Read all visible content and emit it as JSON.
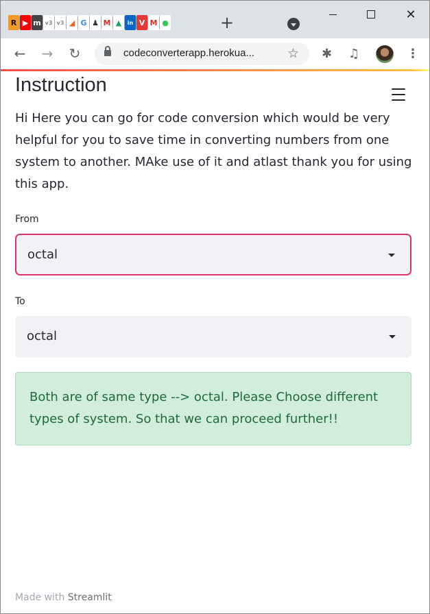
{
  "browser": {
    "tab_favicons": [
      {
        "name": "r-icon",
        "glyph": "R",
        "bg": "#f59a23",
        "fg": "#111111"
      },
      {
        "name": "youtube-icon",
        "glyph": "▶",
        "bg": "#ff0000",
        "fg": "#ffffff"
      },
      {
        "name": "app-icon",
        "glyph": "m",
        "bg": "#444444",
        "fg": "#ffffff"
      },
      {
        "name": "v3-icon",
        "glyph": "v3",
        "bg": "#ffffff",
        "fg": "#888888"
      },
      {
        "name": "v3-icon",
        "glyph": "v3",
        "bg": "#ffffff",
        "fg": "#888888"
      },
      {
        "name": "pdf-icon",
        "glyph": "◢",
        "bg": "#ffffff",
        "fg": "#e0662c"
      },
      {
        "name": "google-icon",
        "glyph": "G",
        "bg": "#ffffff",
        "fg": "#4285f4"
      },
      {
        "name": "person-icon",
        "glyph": "♟",
        "bg": "#ffffff",
        "fg": "#333333"
      },
      {
        "name": "gmail-icon",
        "glyph": "M",
        "bg": "#ffffff",
        "fg": "#d93025"
      },
      {
        "name": "drive-icon",
        "glyph": "▲",
        "bg": "#ffffff",
        "fg": "#1fa463"
      },
      {
        "name": "linkedin-icon",
        "glyph": "in",
        "bg": "#0a66c2",
        "fg": "#ffffff"
      },
      {
        "name": "v-red-icon",
        "glyph": "V",
        "bg": "#e53935",
        "fg": "#ffffff"
      },
      {
        "name": "gmail-icon",
        "glyph": "M",
        "bg": "#ffffff",
        "fg": "#d93025"
      },
      {
        "name": "green-dot-icon",
        "glyph": "●",
        "bg": "#ffffff",
        "fg": "#34c759"
      }
    ],
    "new_tab": "+",
    "url": "codeconverterapp.herokua...",
    "close_glyph": "✕"
  },
  "app": {
    "title": "Instruction",
    "instruction": "Hi Here you can go for code conversion which would be very helpful for you to save time in converting numbers from one system to another. MAke use of it and atlast thank you for using this app.",
    "from": {
      "label": "From",
      "value": "octal"
    },
    "to": {
      "label": "To",
      "value": "octal"
    },
    "alert": "Both are of same type --> octal. Please Choose different types of system. So that we can proceed further!!",
    "footer": {
      "prefix": "Made with",
      "brand": "Streamlit"
    }
  },
  "colors": {
    "accent": "#ff4b4b",
    "focus_border": "#e0306d",
    "success_bg": "#d0eed9",
    "success_text": "#1e6a3a"
  }
}
